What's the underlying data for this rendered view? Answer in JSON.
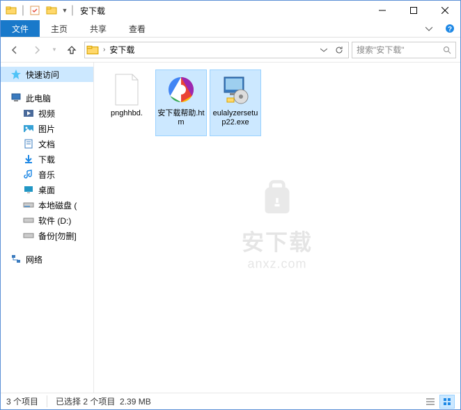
{
  "window": {
    "title": "安下载"
  },
  "ribbon": {
    "file": "文件",
    "tabs": [
      "主页",
      "共享",
      "查看"
    ]
  },
  "address": {
    "crumb": "安下载",
    "search_placeholder": "搜索\"安下载\""
  },
  "sidebar": {
    "quick": "快速访问",
    "pc": "此电脑",
    "pc_children": [
      "视频",
      "图片",
      "文档",
      "下载",
      "音乐",
      "桌面",
      "本地磁盘 (",
      "软件 (D:)",
      "备份[勿删]"
    ],
    "network": "网络"
  },
  "files": [
    {
      "name": "pnghhbd.",
      "selected": false,
      "type": "blank"
    },
    {
      "name": "安下载帮助.htm",
      "selected": true,
      "type": "htm"
    },
    {
      "name": "eulalyzersetup22.exe",
      "selected": true,
      "type": "installer"
    }
  ],
  "status": {
    "count": "3 个项目",
    "selection": "已选择 2 个项目",
    "size": "2.39 MB"
  },
  "watermark": {
    "text": "安下载",
    "sub": "anxz.com"
  }
}
